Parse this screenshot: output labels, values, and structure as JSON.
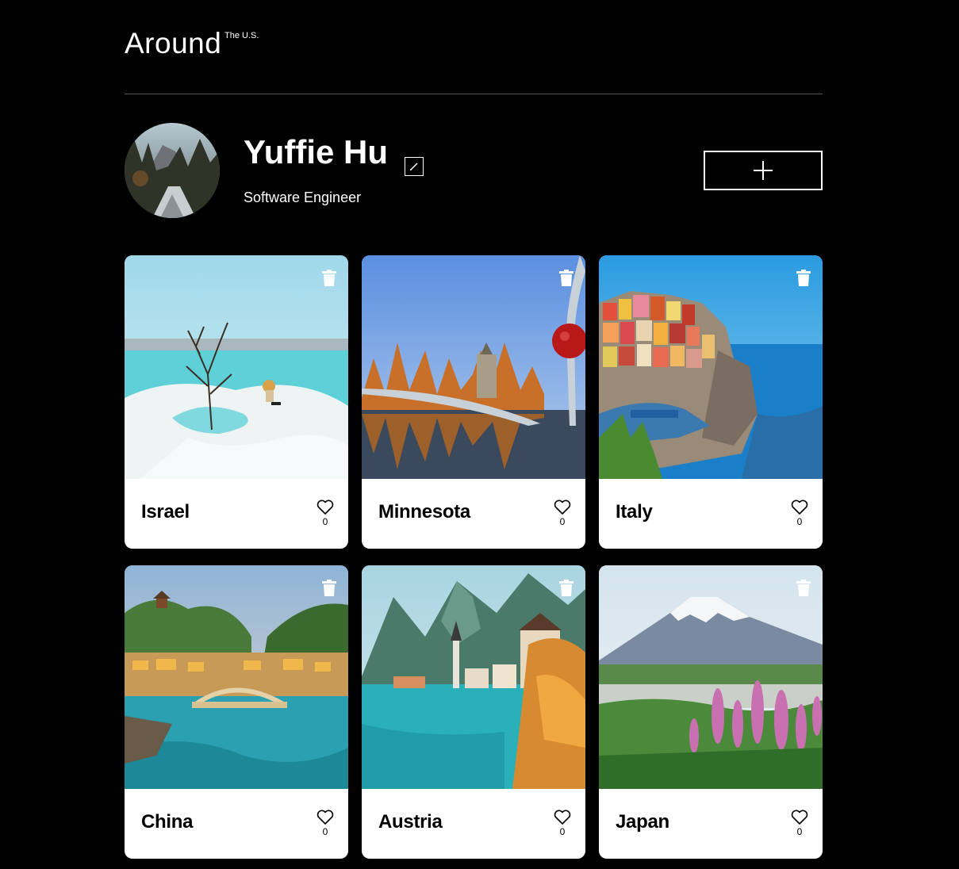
{
  "header": {
    "logo": "Around",
    "logo_sup": "The U.S."
  },
  "profile": {
    "name": "Yuffie Hu",
    "job": "Software Engineer"
  },
  "cards": [
    {
      "title": "Israel",
      "likes": "0"
    },
    {
      "title": "Minnesota",
      "likes": "0"
    },
    {
      "title": "Italy",
      "likes": "0"
    },
    {
      "title": "China",
      "likes": "0"
    },
    {
      "title": "Austria",
      "likes": "0"
    },
    {
      "title": "Japan",
      "likes": "0"
    }
  ],
  "icons": {
    "edit": "pencil-icon",
    "add": "plus-icon",
    "delete": "trash-icon",
    "like": "heart-icon"
  }
}
